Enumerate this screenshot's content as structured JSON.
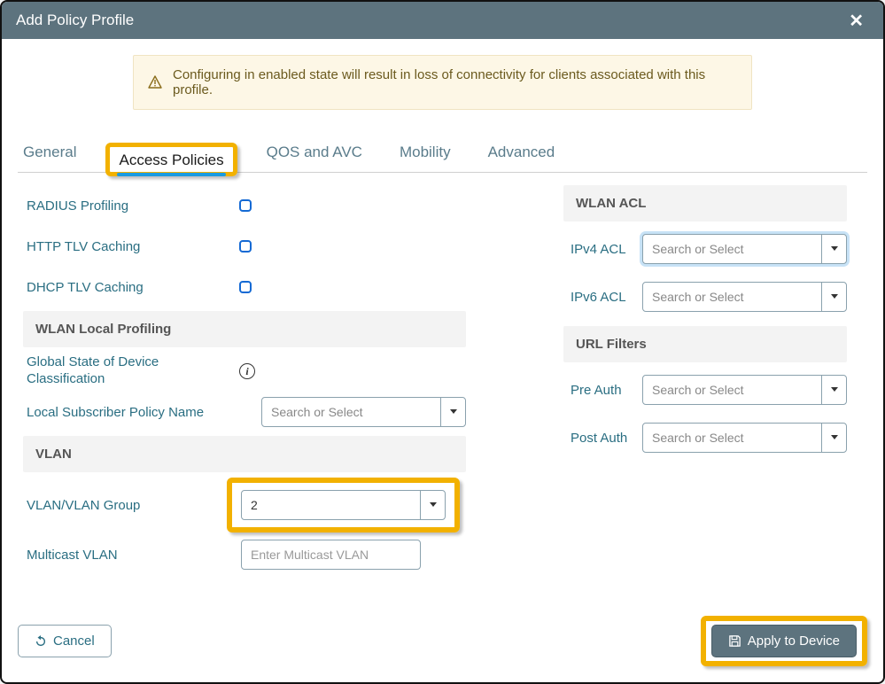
{
  "window": {
    "title": "Add Policy Profile"
  },
  "alert": {
    "text": "Configuring in enabled state will result in loss of connectivity for clients associated with this profile."
  },
  "tabs": {
    "general": "General",
    "access_policies": "Access Policies",
    "qos_avc": "QOS and AVC",
    "mobility": "Mobility",
    "advanced": "Advanced",
    "active": "access_policies"
  },
  "left": {
    "radius_profiling": "RADIUS Profiling",
    "http_tlv": "HTTP TLV Caching",
    "dhcp_tlv": "DHCP TLV Caching",
    "wlan_local_profiling_hdr": "WLAN Local Profiling",
    "global_state": "Global State of Device Classification",
    "local_subscriber": "Local Subscriber Policy Name",
    "local_subscriber_placeholder": "Search or Select",
    "vlan_hdr": "VLAN",
    "vlan_group": "VLAN/VLAN Group",
    "vlan_group_value": "2",
    "multicast_vlan": "Multicast VLAN",
    "multicast_vlan_placeholder": "Enter Multicast VLAN"
  },
  "right": {
    "wlan_acl_hdr": "WLAN ACL",
    "ipv4_acl": "IPv4 ACL",
    "ipv6_acl": "IPv6 ACL",
    "url_filters_hdr": "URL Filters",
    "pre_auth": "Pre Auth",
    "post_auth": "Post Auth",
    "combo_placeholder": "Search or Select"
  },
  "footer": {
    "cancel": "Cancel",
    "apply": "Apply to Device"
  }
}
